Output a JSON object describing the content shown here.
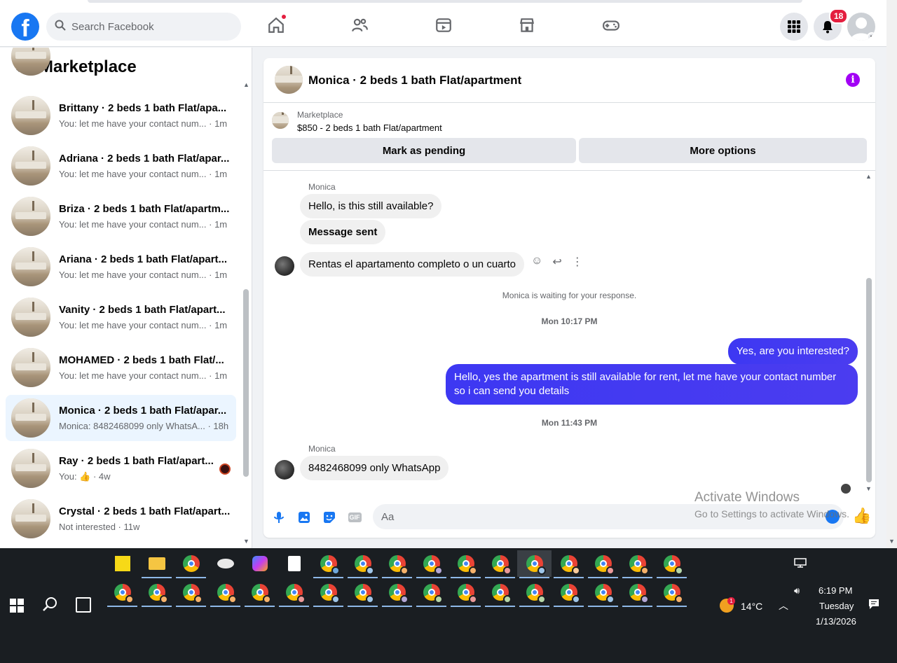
{
  "topnav": {
    "logo_letter": "f",
    "search_placeholder": "Search Facebook",
    "nav_icons": [
      "home-icon",
      "friends-icon",
      "video-icon",
      "marketplace-icon",
      "gaming-icon"
    ],
    "notifications_count": "18"
  },
  "sidebar": {
    "title": "Marketplace",
    "conversations": [
      {
        "title": "Brittany · 2 beds 1 bath Flat/apa...",
        "preview": "You: let me have your contact num... · 1m",
        "active": false
      },
      {
        "title": "Adriana · 2 beds 1 bath Flat/apar...",
        "preview": "You: let me have your contact num... · 1m",
        "active": false
      },
      {
        "title": "Briza · 2 beds 1 bath Flat/apartm...",
        "preview": "You: let me have your contact num... · 1m",
        "active": false
      },
      {
        "title": "Ariana · 2 beds 1 bath Flat/apart...",
        "preview": "You: let me have your contact num... · 1m",
        "active": false
      },
      {
        "title": "Vanity · 2 beds 1 bath Flat/apart...",
        "preview": "You: let me have your contact num... · 1m",
        "active": false
      },
      {
        "title": "MOHAMED · 2 beds 1 bath Flat/...",
        "preview": "You: let me have your contact num... · 1m",
        "active": false
      },
      {
        "title": "Monica · 2 beds 1 bath Flat/apar...",
        "preview": "Monica: 8482468099 only WhatsA... · 18h",
        "active": true
      },
      {
        "title": "Ray · 2 beds 1 bath Flat/apart...",
        "preview": "You: 👍 · 4w",
        "active": false
      },
      {
        "title": "Crystal · 2 beds 1 bath Flat/apart...",
        "preview": "Not interested · 11w",
        "active": false
      }
    ]
  },
  "chat": {
    "title": "Monica · 2 beds 1 bath Flat/apartment",
    "listing_label": "Marketplace",
    "listing_price": "$850 - 2 beds 1 bath Flat/apartment",
    "mark_pending_label": "Mark as pending",
    "more_options_label": "More options",
    "sender_name_1": "Monica",
    "msg_1": "Hello, is this still available?",
    "msg_2": "Message sent",
    "msg_3": "Rentas el apartamento completo o un cuarto",
    "waiting_notice": "Monica is waiting for your response.",
    "timestamp_1": "Mon 10:17 PM",
    "out_1": "Yes, are you interested?",
    "out_2": "Hello, yes the apartment is still available for rent, let me have your contact number so i can send you details",
    "timestamp_2": "Mon 11:43 PM",
    "sender_name_2": "Monica",
    "msg_4": "8482468099 only WhatsApp",
    "composer_placeholder": "Aa"
  },
  "watermark": {
    "line1": "Activate Windows",
    "line2": "Go to Settings to activate Windows."
  },
  "taskbar": {
    "weather": "14°C",
    "weather_badge": "1",
    "time": "6:19 PM",
    "day": "Tuesday",
    "date": "1/13/2026"
  },
  "colors": {
    "fb_blue": "#1877f2",
    "outgoing_bubble": "#3d38f2",
    "active_row": "#ebf5ff",
    "info_purple": "#a200f5"
  }
}
